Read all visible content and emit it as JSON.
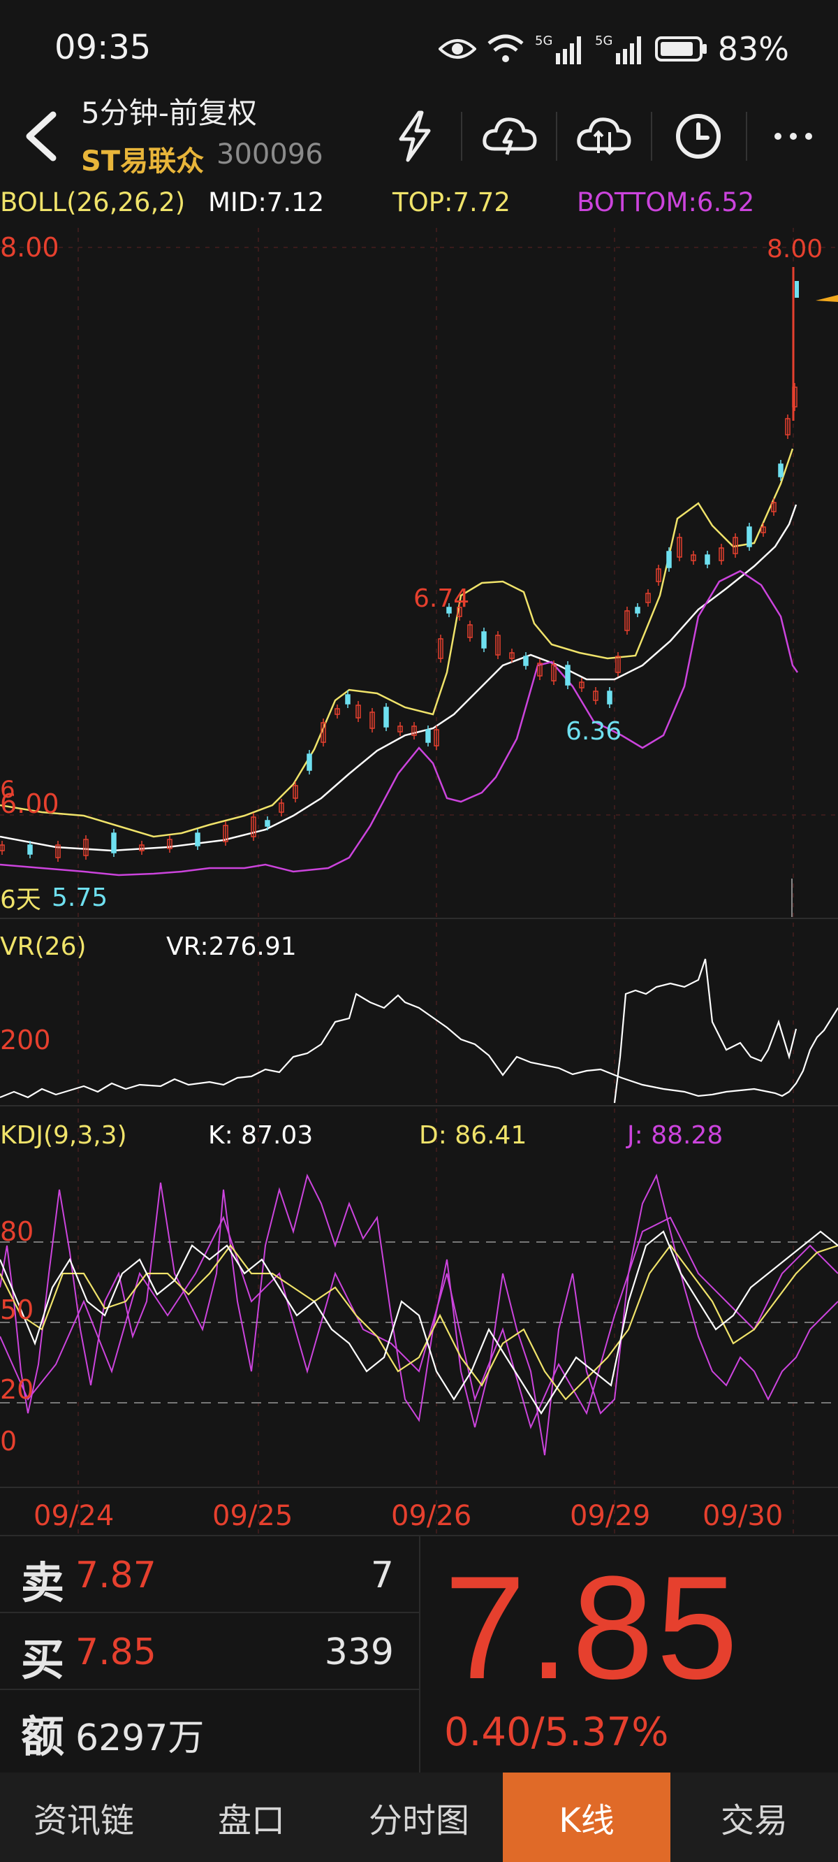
{
  "status_bar": {
    "time": "09:35",
    "battery": "83%",
    "net1": "5G",
    "net2": "5G"
  },
  "header": {
    "title": "5分钟-前复权",
    "stock_name": "ST易联众",
    "stock_code": "300096",
    "icons": [
      "lightning-icon",
      "cloud-lightning-icon",
      "cloud-sync-icon",
      "clock-icon",
      "more-icon"
    ]
  },
  "boll": {
    "label": "BOLL(26,26,2)",
    "mid": "MID:7.12",
    "top": "TOP:7.72",
    "bottom": "BOTTOM:6.52"
  },
  "main_chart": {
    "y_top_label": "8.00",
    "y_mid_label": "6.00",
    "high_label": "8.00",
    "peak_label": "6.74",
    "trough_label": "6.36",
    "low_label": "5.75",
    "days_label": "6天",
    "overlap_label": "6"
  },
  "vr": {
    "label": "VR(26)",
    "value": "VR:276.91",
    "level_label": "200"
  },
  "kdj": {
    "label": "KDJ(9,3,3)",
    "k": "K: 87.03",
    "d": "D: 86.41",
    "j": "J: 88.28",
    "levels": [
      "80",
      "50",
      "20",
      "0"
    ]
  },
  "dates": [
    "09/24",
    "09/25",
    "09/26",
    "09/29",
    "09/30"
  ],
  "quote": {
    "sell_label": "卖",
    "sell_price": "7.87",
    "sell_vol": "7",
    "buy_label": "买",
    "buy_price": "7.85",
    "buy_vol": "339",
    "amount_label": "额",
    "amount": "6297万",
    "price": "7.85",
    "change": "0.40/5.37%"
  },
  "tabs": [
    "资讯链",
    "盘口",
    "分时图",
    "K线",
    "交易"
  ],
  "colors": {
    "up": "#e6402e",
    "down": "#6fe0f0",
    "mid": "#ffffff",
    "top": "#f0e36a",
    "bottom": "#cc44dd",
    "accent": "#e06a28"
  }
}
